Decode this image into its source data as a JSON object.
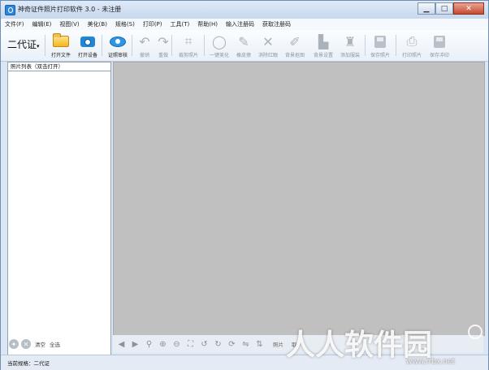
{
  "window": {
    "title": "神奇证件照片打印软件 3.0 - 未注册",
    "buttons": [
      "minimize",
      "maximize",
      "close"
    ]
  },
  "menu": [
    "文件(F)",
    "编辑(E)",
    "视图(V)",
    "美化(B)",
    "规格(S)",
    "打印(P)",
    "工具(T)",
    "帮助(H)",
    "输入注册码",
    "获取注册码"
  ],
  "toolbar": {
    "spec": "二代证",
    "items": [
      {
        "label": "打开文件",
        "icon": "folder-icon",
        "enabled": true
      },
      {
        "label": "打开设备",
        "icon": "camera-icon",
        "enabled": true
      },
      {
        "label": "证照审核",
        "icon": "eye-icon",
        "enabled": true
      },
      {
        "label": "撤销",
        "icon": "undo-icon",
        "enabled": false
      },
      {
        "label": "重做",
        "icon": "redo-icon",
        "enabled": false
      },
      {
        "label": "裁剪照片",
        "icon": "crop-icon",
        "enabled": false
      },
      {
        "label": "一键美化",
        "icon": "beautify-icon",
        "enabled": false
      },
      {
        "label": "橡皮擦",
        "icon": "eraser-icon",
        "enabled": false
      },
      {
        "label": "消除红眼",
        "icon": "red-eye-icon",
        "enabled": false
      },
      {
        "label": "背景抠图",
        "icon": "magic-wand-icon",
        "enabled": false
      },
      {
        "label": "背景设置",
        "icon": "background-icon",
        "enabled": false
      },
      {
        "label": "添加服装",
        "icon": "clothes-icon",
        "enabled": false
      },
      {
        "label": "保存照片",
        "icon": "save-icon",
        "enabled": false
      },
      {
        "label": "打印照片",
        "icon": "printer-icon",
        "enabled": false
      },
      {
        "label": "保存冲印",
        "icon": "print-save-icon",
        "enabled": false
      }
    ]
  },
  "left_panel": {
    "title": "照片列表（双击打开）",
    "actions": [
      "清空",
      "全选"
    ]
  },
  "bottom_toolbar": {
    "text_labels": [
      "照片",
      "取"
    ]
  },
  "status": {
    "text": "当前规格：二代证"
  },
  "watermark": {
    "text": "人人软件园",
    "url": "www.rrbx.net"
  }
}
